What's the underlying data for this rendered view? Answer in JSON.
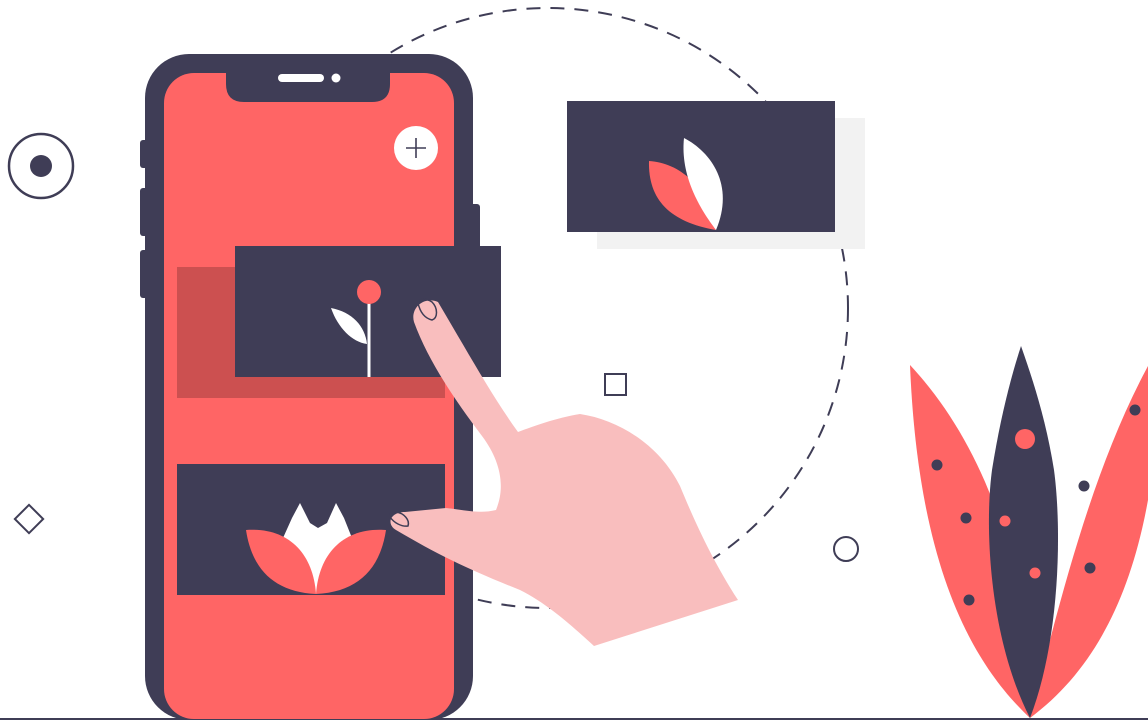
{
  "illustration": {
    "subject": "phone-gallery-tap",
    "colors": {
      "dark": "#3f3d56",
      "accent": "#ff6565",
      "accent_shade": "#cc5050",
      "skin": "#f9bebe",
      "light_panel": "#f2f2f2",
      "white": "#ffffff"
    },
    "icons": [
      "plus-icon",
      "tulip-icon",
      "sprout-icon",
      "leaf-icon",
      "hand-pointer-icon",
      "target-circle-icon",
      "diamond-icon",
      "square-icon",
      "circle-icon",
      "plant-icon"
    ]
  }
}
